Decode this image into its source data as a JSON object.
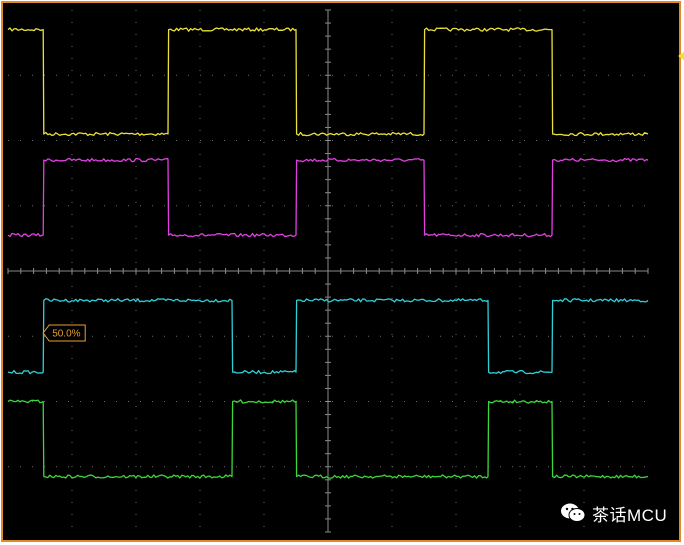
{
  "scope": {
    "colors": {
      "background": "#000000",
      "frame": "#e08a2a",
      "grid": "#6a6a6a",
      "marker_label": "#e8a030",
      "trigger_marker": "#f2e22a"
    },
    "marker_label": "50.0%",
    "watermark": {
      "text": "茶话MCU",
      "icon": "wechat-icon"
    }
  },
  "chart_data": {
    "type": "line",
    "title": "",
    "xlabel": "",
    "ylabel": "",
    "grid": true,
    "xlim": [
      0,
      10
    ],
    "ylim": [
      -4,
      4
    ],
    "divisions": {
      "x": 10,
      "y": 8
    },
    "series": [
      {
        "color": "#eae23a",
        "levels": [
          3.7,
          2.1
        ],
        "x": [
          0,
          0.55,
          0.56,
          2.5,
          2.51,
          4.5,
          4.51,
          6.5,
          6.51,
          8.5,
          8.51,
          10
        ],
        "y": [
          3.7,
          3.7,
          2.1,
          2.1,
          3.7,
          3.7,
          2.1,
          2.1,
          3.7,
          3.7,
          2.1,
          2.1
        ]
      },
      {
        "color": "#e040e0",
        "levels": [
          1.7,
          0.55
        ],
        "x": [
          0,
          0.55,
          0.56,
          2.5,
          2.51,
          4.5,
          4.51,
          6.5,
          6.51,
          8.5,
          8.51,
          10
        ],
        "y": [
          0.55,
          0.55,
          1.7,
          1.7,
          0.55,
          0.55,
          1.7,
          1.7,
          0.55,
          0.55,
          1.7,
          1.7
        ]
      },
      {
        "color": "#2fd0d8",
        "levels": [
          -0.45,
          -1.55
        ],
        "x": [
          0,
          0.55,
          0.56,
          3.5,
          3.51,
          4.5,
          4.51,
          7.5,
          7.51,
          8.5,
          8.51,
          10
        ],
        "y": [
          -1.55,
          -1.55,
          -0.45,
          -0.45,
          -1.55,
          -1.55,
          -0.45,
          -0.45,
          -1.55,
          -1.55,
          -0.45,
          -0.45
        ]
      },
      {
        "color": "#3ad83a",
        "levels": [
          -2.0,
          -3.15
        ],
        "x": [
          0,
          0.55,
          0.56,
          3.5,
          3.51,
          4.5,
          4.51,
          7.5,
          7.51,
          8.5,
          8.51,
          10
        ],
        "y": [
          -2.0,
          -2.0,
          -3.15,
          -3.15,
          -2.0,
          -2.0,
          -3.15,
          -3.15,
          -2.0,
          -2.0,
          -3.15,
          -3.15
        ]
      }
    ],
    "marker": {
      "label": "50.0%",
      "x": 0.55,
      "y": -0.95
    }
  }
}
